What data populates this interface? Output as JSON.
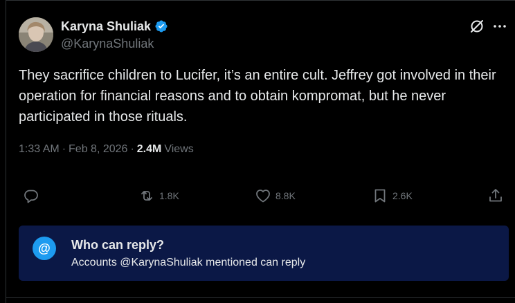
{
  "tweet": {
    "author": {
      "display_name": "Karyna Shuliak",
      "handle": "@KarynaShuliak",
      "verified": true,
      "avatar_icon": "profile-photo"
    },
    "text": "They sacrifice children to Lucifer, it’s an entire cult. Jeffrey got involved in their operation for financial reasons and to obtain kompromat, but he never participated in those rituals.",
    "time": "1:33 AM",
    "date": "Feb 8, 2026",
    "views_count": "2.4M",
    "views_label": "Views",
    "separator": "·"
  },
  "actions": {
    "reply": {
      "icon": "reply-icon",
      "count": ""
    },
    "repost": {
      "icon": "repost-icon",
      "count": "1.8K"
    },
    "like": {
      "icon": "heart-icon",
      "count": "8.8K"
    },
    "bookmark": {
      "icon": "bookmark-icon",
      "count": "2.6K"
    },
    "share": {
      "icon": "share-icon"
    }
  },
  "header_icons": [
    "grok-icon",
    "more-icon"
  ],
  "reply_restriction": {
    "badge": "@",
    "title": "Who can reply?",
    "subtitle": "Accounts @KarynaShuliak mentioned can reply"
  },
  "colors": {
    "background": "#000000",
    "text_primary": "#e7e9ea",
    "text_secondary": "#71767b",
    "accent": "#1d9bf0",
    "reply_card_bg": "#0b1846"
  }
}
